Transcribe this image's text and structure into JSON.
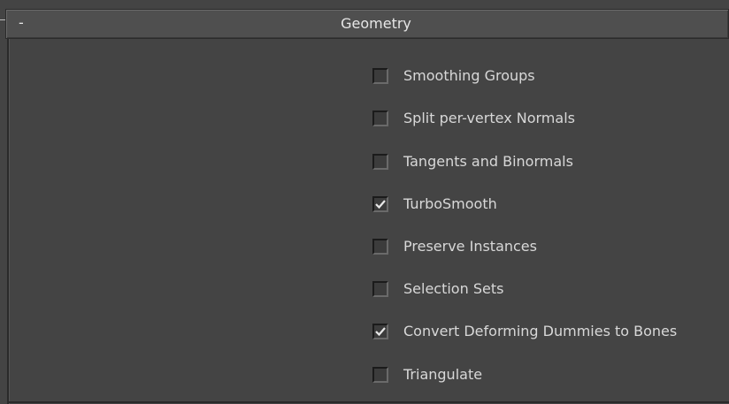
{
  "rollout": {
    "title": "Geometry",
    "collapse_symbol": "-"
  },
  "options": [
    {
      "label": "Smoothing Groups",
      "checked": false
    },
    {
      "label": "Split per-vertex Normals",
      "checked": false
    },
    {
      "label": "Tangents and Binormals",
      "checked": false
    },
    {
      "label": "TurboSmooth",
      "checked": true
    },
    {
      "label": "Preserve Instances",
      "checked": false
    },
    {
      "label": "Selection Sets",
      "checked": false
    },
    {
      "label": "Convert Deforming Dummies to Bones",
      "checked": true
    },
    {
      "label": "Triangulate",
      "checked": false
    }
  ],
  "colors": {
    "background": "#444444",
    "header": "#4f4f4f",
    "text": "#d8d8d8"
  },
  "icons": {
    "collapse": "minus-icon",
    "check": "checkmark-icon"
  }
}
